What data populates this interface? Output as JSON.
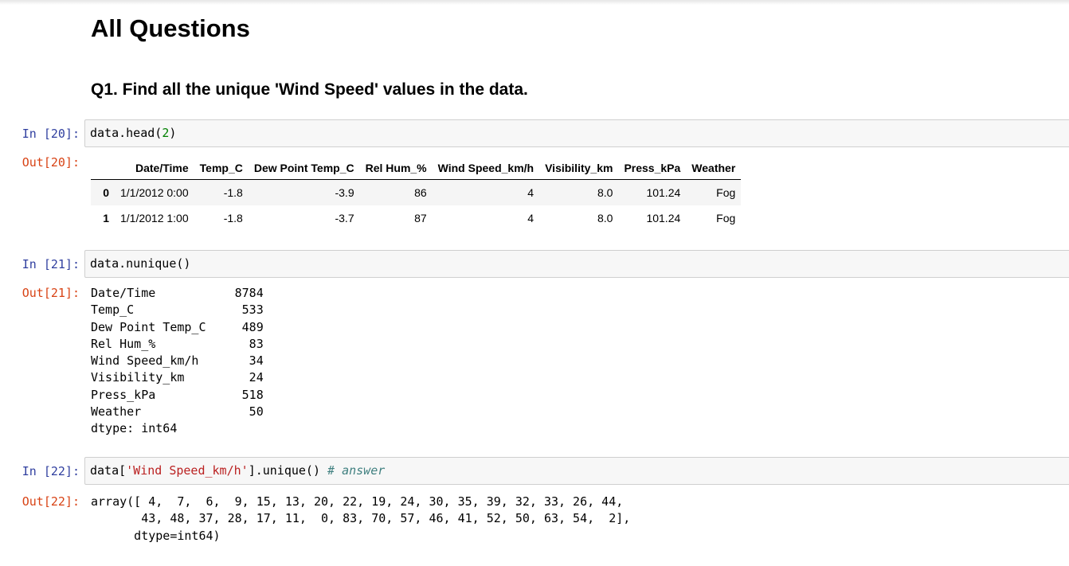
{
  "heading": "All Questions",
  "question": "Q1. Find all the unique 'Wind Speed' values in the data.",
  "cells": {
    "c20": {
      "in_prompt": "In [20]:",
      "out_prompt": "Out[20]:",
      "code": {
        "a": "data.head(",
        "num": "2",
        "b": ")"
      }
    },
    "c21": {
      "in_prompt": "In [21]:",
      "out_prompt": "Out[21]:",
      "code": "data.nunique()",
      "output": "Date/Time           8784\nTemp_C               533\nDew Point Temp_C     489\nRel Hum_%             83\nWind Speed_km/h       34\nVisibility_km         24\nPress_kPa            518\nWeather               50\ndtype: int64"
    },
    "c22": {
      "in_prompt": "In [22]:",
      "out_prompt": "Out[22]:",
      "code": {
        "a": "data[",
        "str": "'Wind Speed_km/h'",
        "b": "].unique() ",
        "comment": "# answer"
      },
      "output": "array([ 4,  7,  6,  9, 15, 13, 20, 22, 19, 24, 30, 35, 39, 32, 33, 26, 44,\n       43, 48, 37, 28, 17, 11,  0, 83, 70, 57, 46, 41, 52, 50, 63, 54,  2],\n      dtype=int64)"
    }
  },
  "dataframe": {
    "columns": [
      "",
      "Date/Time",
      "Temp_C",
      "Dew Point Temp_C",
      "Rel Hum_%",
      "Wind Speed_km/h",
      "Visibility_km",
      "Press_kPa",
      "Weather"
    ],
    "rows": [
      [
        "0",
        "1/1/2012 0:00",
        "-1.8",
        "-3.9",
        "86",
        "4",
        "8.0",
        "101.24",
        "Fog"
      ],
      [
        "1",
        "1/1/2012 1:00",
        "-1.8",
        "-3.7",
        "87",
        "4",
        "8.0",
        "101.24",
        "Fog"
      ]
    ]
  }
}
